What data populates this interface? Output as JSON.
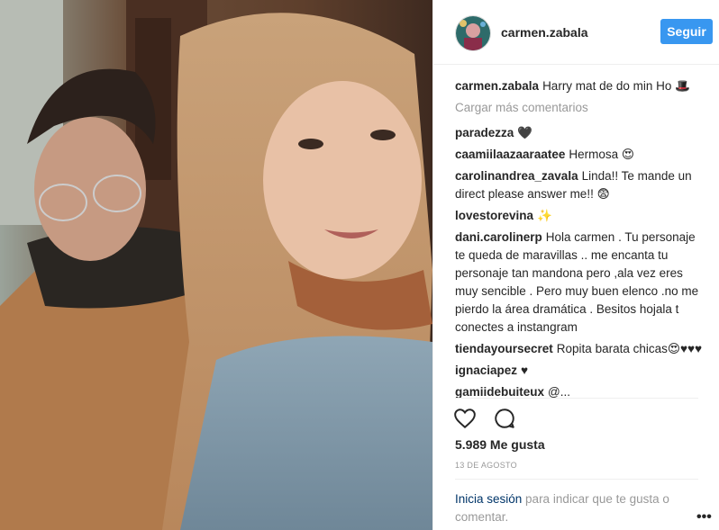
{
  "header": {
    "username": "carmen.zabala",
    "follow_label": "Seguir"
  },
  "caption": {
    "user": "carmen.zabala",
    "text": "Harry mat de do min Ho 🎩"
  },
  "load_more_label": "Cargar más comentarios",
  "comments": [
    {
      "user": "paradezza",
      "text": "🖤"
    },
    {
      "user": "caamiilaazaaraatee",
      "text": "Hermosa 😍"
    },
    {
      "user": "carolinandrea_zavala",
      "text": "Linda!! Te mande un direct please answer me!! 😨"
    },
    {
      "user": "lovestorevina",
      "text": "✨"
    },
    {
      "user": "dani.carolinerp",
      "text": "Hola carmen . Tu personaje te queda de maravillas .. me encanta tu personaje tan mandona pero ,ala vez eres muy sencible . Pero muy buen elenco .no me pierdo la área dramática . Besitos hojala t conectes a instangram"
    },
    {
      "user": "tiendayoursecret",
      "text": "Ropita barata chicas😍♥♥♥"
    },
    {
      "user": "ignaciapez",
      "text": "♥"
    },
    {
      "user": "gamiidebuiteux",
      "text": "@..."
    }
  ],
  "likes_text": "5.989 Me gusta",
  "date_text": "13 DE AGOSTO",
  "login": {
    "link": "Inicia sesión",
    "rest": " para indicar que te gusta o comentar."
  },
  "icons": {
    "like": "heart-icon",
    "comment": "comment-bubble-icon",
    "more": "more-options-icon"
  },
  "colors": {
    "accent": "#3897f0",
    "link": "#003569",
    "muted": "#999999"
  }
}
